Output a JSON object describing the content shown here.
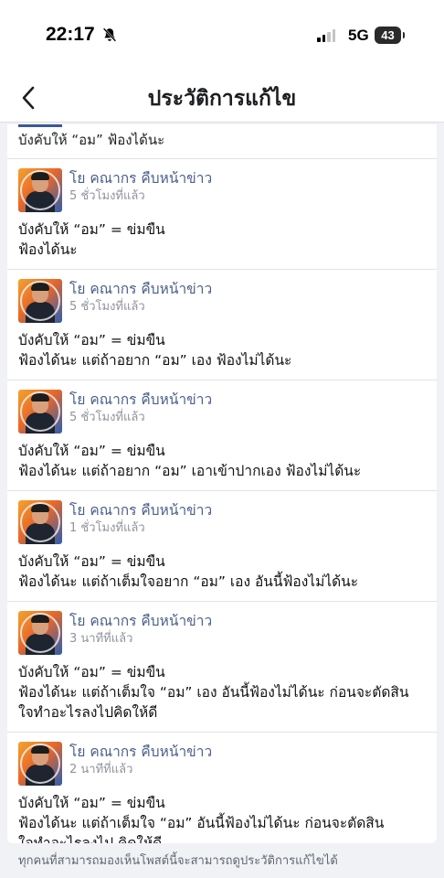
{
  "status_bar": {
    "time": "22:17",
    "network": "5G",
    "battery": "43",
    "icons": [
      "bell-off-icon",
      "signal-icon",
      "battery-icon"
    ]
  },
  "header": {
    "title": "ประวัติการแก้ไข",
    "back_icon": "chevron-left-icon"
  },
  "history": {
    "partial_entry_text": "บังคับให้ “อม” ฟ้องได้นะ",
    "entries": [
      {
        "author": "โย คณากร คืบหน้าข่าว",
        "time": "5 ชั่วโมงที่แล้ว",
        "text": "บังคับให้ “อม” = ข่มขืน\nฟ้องได้นะ"
      },
      {
        "author": "โย คณากร คืบหน้าข่าว",
        "time": "5 ชั่วโมงที่แล้ว",
        "text": "บังคับให้ “อม” = ข่มขืน\nฟ้องได้นะ แต่ถ้าอยาก “อม” เอง ฟ้องไม่ได้นะ"
      },
      {
        "author": "โย คณากร คืบหน้าข่าว",
        "time": "5 ชั่วโมงที่แล้ว",
        "text": "บังคับให้ “อม” = ข่มขืน\nฟ้องได้นะ แต่ถ้าอยาก “อม” เอาเข้าปากเอง ฟ้องไม่ได้นะ"
      },
      {
        "author": "โย คณากร คืบหน้าข่าว",
        "time": "1 ชั่วโมงที่แล้ว",
        "text": "บังคับให้ “อม” = ข่มขืน\nฟ้องได้นะ แต่ถ้าเต็มใจอยาก “อม” เอง อันนี้ฟ้องไม่ได้นะ"
      },
      {
        "author": "โย คณากร คืบหน้าข่าว",
        "time": "3 นาทีที่แล้ว",
        "text": "บังคับให้ “อม” = ข่มขืน\nฟ้องได้นะ แต่ถ้าเต็มใจ “อม” เอง อันนี้ฟ้องไม่ได้นะ ก่อนจะตัดสิน\nใจทำอะไรลงไปคิดให้ดี"
      },
      {
        "author": "โย คณากร คืบหน้าข่าว",
        "time": "2 นาทีที่แล้ว",
        "text": "บังคับให้ “อม” = ข่มขืน\nฟ้องได้นะ แต่ถ้าเต็มใจ “อม” อันนี้ฟ้องไม่ได้นะ ก่อนจะตัดสิน\nใจทำอะไรลงไป คิดให้ดี"
      }
    ]
  },
  "footer": {
    "note": "ทุกคนที่สามารถมองเห็นโพสต์นี้จะสามารถดูประวัติการแก้ไขได้"
  }
}
